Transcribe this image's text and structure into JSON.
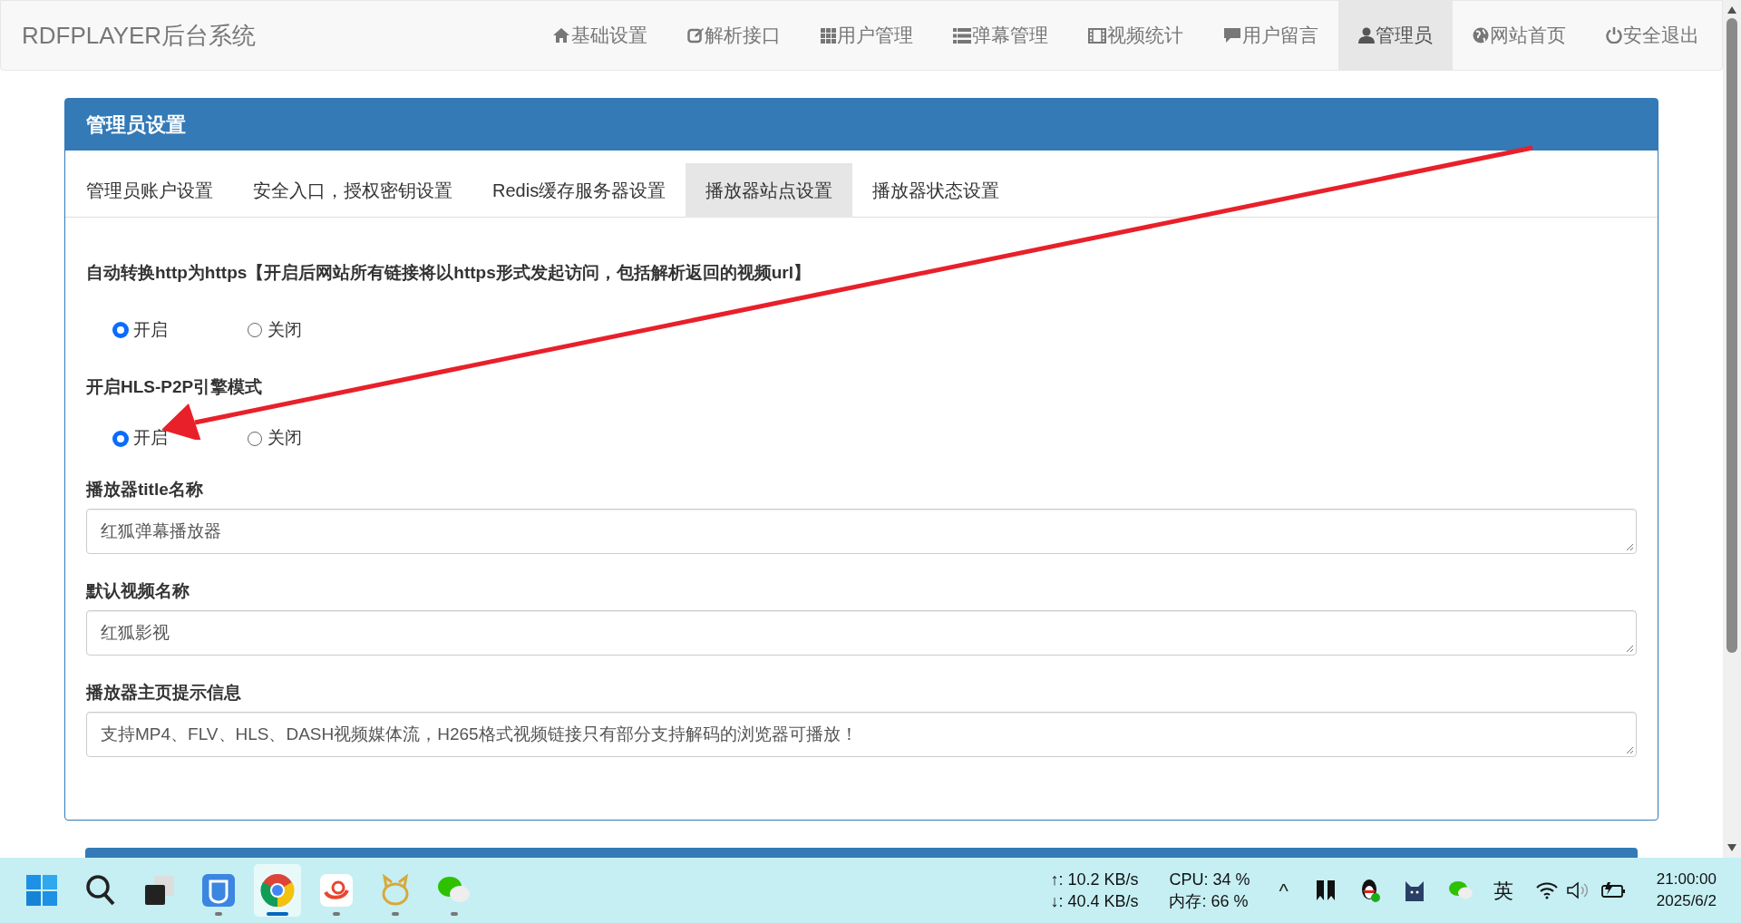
{
  "navbar": {
    "brand": "RDFPLAYER后台系统",
    "items": [
      {
        "label": "基础设置",
        "selected": false
      },
      {
        "label": "解析接口",
        "selected": false
      },
      {
        "label": "用户管理",
        "selected": false
      },
      {
        "label": "弹幕管理",
        "selected": false
      },
      {
        "label": "视频统计",
        "selected": false
      },
      {
        "label": "用户留言",
        "selected": false
      },
      {
        "label": "管理员",
        "selected": true
      },
      {
        "label": "网站首页",
        "selected": false
      },
      {
        "label": "安全退出",
        "selected": false
      }
    ]
  },
  "panel": {
    "title": "管理员设置",
    "tabs": [
      {
        "label": "管理员账户设置",
        "selected": false
      },
      {
        "label": "安全入口，授权密钥设置",
        "selected": false
      },
      {
        "label": "Redis缓存服务器设置",
        "selected": false
      },
      {
        "label": "播放器站点设置",
        "selected": true
      },
      {
        "label": "播放器状态设置",
        "selected": false
      }
    ],
    "fields": [
      {
        "kind": "radio",
        "label": "自动转换http为https【开启后网站所有链接将以https形式发起访问，包括解析返回的视频url】",
        "options": [
          {
            "label": "开启",
            "selected": true
          },
          {
            "label": "关闭",
            "selected": false
          }
        ]
      },
      {
        "kind": "radio",
        "label": "开启HLS-P2P引擎模式",
        "options": [
          {
            "label": "开启",
            "selected": true
          },
          {
            "label": "关闭",
            "selected": false
          }
        ]
      },
      {
        "kind": "textarea",
        "label": "播放器title名称",
        "value": "红狐弹幕播放器"
      },
      {
        "kind": "textarea",
        "label": "默认视频名称",
        "value": "红狐影视"
      },
      {
        "kind": "textarea",
        "label": "播放器主页提示信息",
        "value": "支持MP4、FLV、HLS、DASH视频媒体流，H265格式视频链接只有部分支持解码的浏览器可播放！"
      }
    ]
  },
  "taskbar": {
    "apps": [
      {
        "running": false,
        "selected": false
      },
      {
        "running": false,
        "selected": false
      },
      {
        "running": false,
        "selected": false
      },
      {
        "running": true,
        "selected": false
      },
      {
        "running": true,
        "selected": true
      },
      {
        "running": true,
        "selected": false
      },
      {
        "running": true,
        "selected": false
      },
      {
        "running": true,
        "selected": false
      }
    ],
    "net_up": "↑: 10.2 KB/s",
    "net_down": "↓: 40.4 KB/s",
    "cpu": "CPU: 34 %",
    "memory": "内存: 66 %",
    "tray_caret": "^",
    "ime": "英",
    "time": "21:00:00",
    "date": "2025/6/2"
  }
}
